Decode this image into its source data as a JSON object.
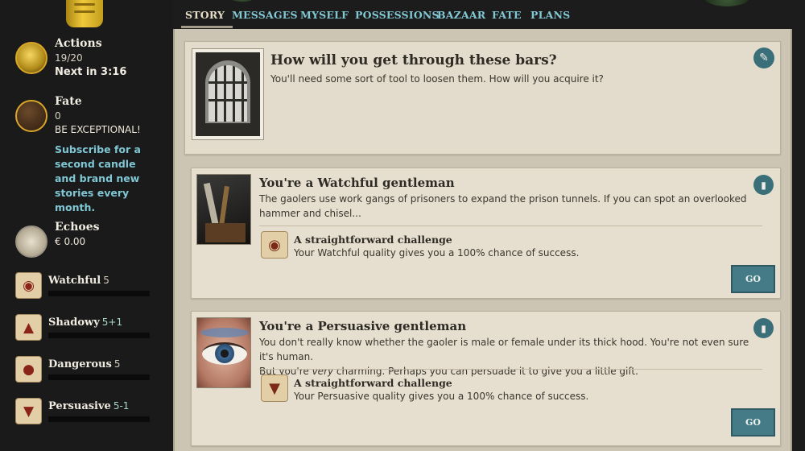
{
  "tabs": [
    "STORY",
    "MESSAGES",
    "MYSELF",
    "POSSESSIONS",
    "BAZAAR",
    "FATE",
    "PLANS"
  ],
  "sidebar": {
    "actions": {
      "label": "Actions",
      "value": "19/20",
      "next": "Next in 3:16"
    },
    "fate": {
      "label": "Fate",
      "value": "0",
      "tagline": "BE EXCEPTIONAL!"
    },
    "subscribe": "Subscribe for a second candle and brand new stories every month.",
    "echoes": {
      "label": "Echoes",
      "value": "€ 0.00"
    },
    "qualities": [
      {
        "name": "Watchful",
        "level": "5",
        "icon": "watchful-owl-icon"
      },
      {
        "name": "Shadowy",
        "level": "5+1",
        "icon": "shadowy-cat-icon"
      },
      {
        "name": "Dangerous",
        "level": "5",
        "icon": "dangerous-bear-icon"
      },
      {
        "name": "Persuasive",
        "level": "5-1",
        "icon": "persuasive-fox-icon"
      }
    ]
  },
  "story": {
    "title": "How will you get through these bars?",
    "description": "You'll need some sort of tool to loosen them. How will you acquire it?",
    "image": "barred-window"
  },
  "branches": [
    {
      "title": "You're a Watchful gentleman",
      "description": "The gaolers use work gangs of prisoners to expand the prison tunnels. If you can spot an overlooked hammer and chisel...",
      "challenge_title": "A straightforward challenge",
      "challenge_desc": "Your Watchful quality gives you a 100% chance of success.",
      "button": "GO",
      "image": "tools"
    },
    {
      "title": "You're a Persuasive gentleman",
      "description_1": "You don't really know whether the gaoler is male or female under its thick hood. You're not even sure it's human.",
      "description_2a": "But you're ",
      "description_2b": "very",
      "description_2c": " charming. Perhaps you can persuade it to give you a little gift.",
      "challenge_title": "A straightforward challenge",
      "challenge_desc": "Your Persuasive quality gives you a 100% chance of success.",
      "button": "GO",
      "image": "eye"
    }
  ],
  "colors": {
    "tab_link": "#82c8d4",
    "accent_button": "#457b86",
    "parchment": "#e6dfd0",
    "candle": "#f0c93a"
  }
}
